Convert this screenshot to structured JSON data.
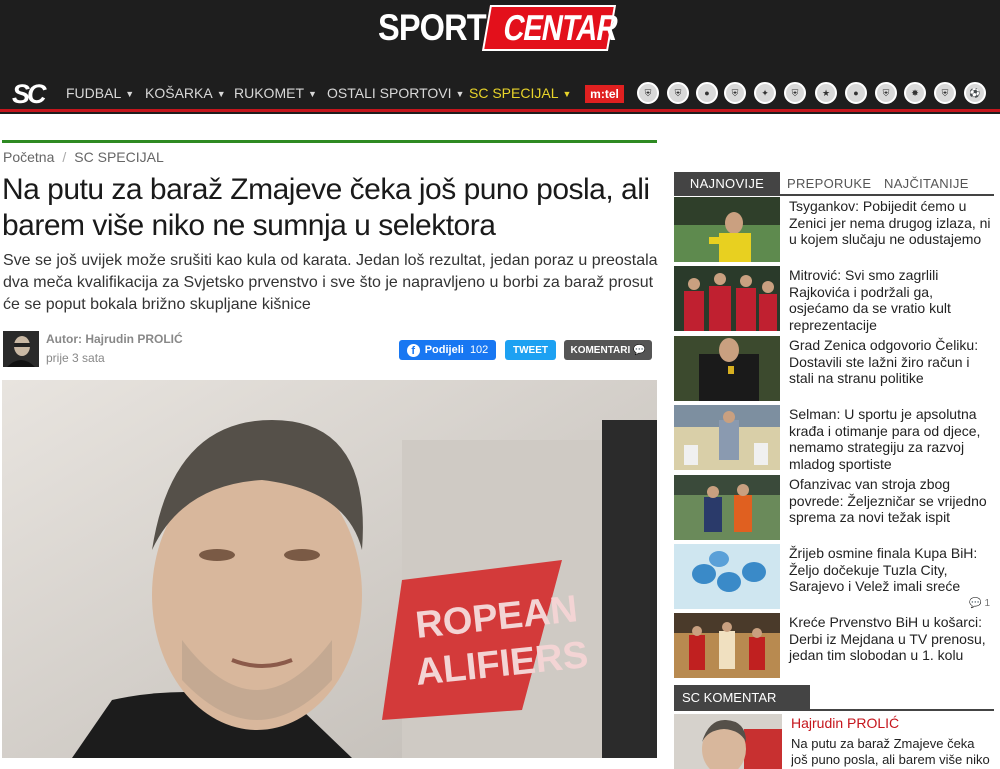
{
  "header": {
    "logo_left": "SPORT",
    "logo_right": "CENTAR",
    "nav_logo": "SC",
    "nav": [
      {
        "label": "FUDBAL"
      },
      {
        "label": "KOŠARKA"
      },
      {
        "label": "RUKOMET"
      },
      {
        "label": "OSTALI SPORTOVI"
      },
      {
        "label": "SC SPECIJAL"
      }
    ],
    "sponsor": "m:tel",
    "accent_color": "#c5151c",
    "special_color": "#e8d42a"
  },
  "breadcrumb": {
    "home": "Početna",
    "separator": "/",
    "current": "SC SPECIJAL"
  },
  "article": {
    "title": "Na putu za baraž Zmajeve čeka još puno posla, ali barem više niko ne sumnja u selektora",
    "lead": "Sve se još uvijek može srušiti kao kula od karata. Jedan loš rezultat, jedan poraz u preostala dva meča kvalifikacija za Svjetsko prvenstvo i sve što je napravljeno u borbi za baraž prosut će se poput bokala brižno skupljane kišnice",
    "author_label": "Autor: Hajrudin PROLIĆ",
    "time": "prije 3 sata",
    "share_label": "Podijeli",
    "share_count": "102",
    "tweet_label": "TWEET",
    "comments_label": "KOMENTARI",
    "image_text": "ROPEAN\nALIFIERS"
  },
  "sidebar": {
    "tabs": [
      "NAJNOVIJE",
      "PREPORUKE",
      "NAJČITANIJE"
    ],
    "news": [
      {
        "title": "Tsygankov: Pobijedit ćemo u Zenici jer nema drugog izlaza, ni u kojem slučaju ne odustajemo"
      },
      {
        "title": "Mitrović: Svi smo zagrlili Rajkovića i podržali ga, osjećamo da se vratio kult reprezentacije"
      },
      {
        "title": "Grad Zenica odgovorio Čeliku: Dostavili ste lažni žiro račun i stali na stranu politike"
      },
      {
        "title": "Selman: U sportu je apsolutna krađa i otimanje para od djece, nemamo strategiju za razvoj mladog sportiste"
      },
      {
        "title": "Ofanzivac van stroja zbog povrede: Željezničar se vrijedno sprema za novi težak ispit"
      },
      {
        "title": "Žrijeb osmine finala Kupa BiH: Željo dočekuje Tuzla City, Sarajevo i Velež imali sreće",
        "comments": "1"
      },
      {
        "title": "Kreće Prvenstvo BiH u košarci: Derbi iz Mejdana u TV prenosu, jedan tim slobodan u 1. kolu"
      }
    ],
    "sc_komentar": {
      "header": "SC KOMENTAR",
      "author": "Hajrudin PROLIĆ",
      "text": "Na putu za baraž Zmajeve čeka još puno posla, ali barem više niko ne sumnja u selektora"
    }
  }
}
